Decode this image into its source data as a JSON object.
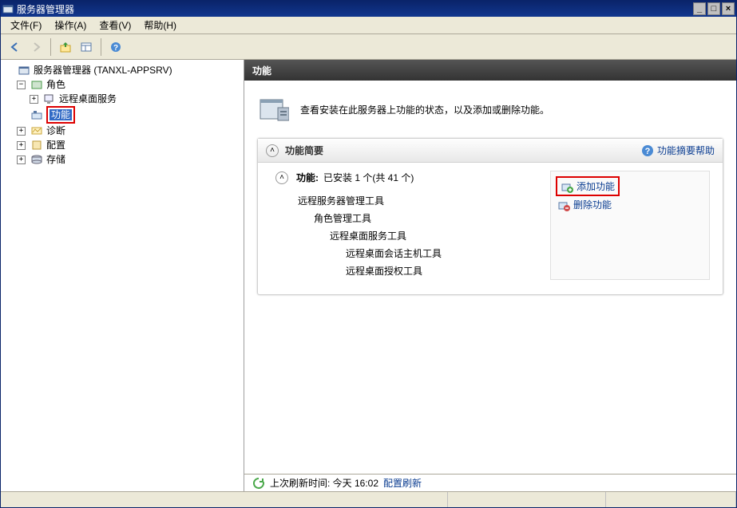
{
  "window": {
    "title": "服务器管理器"
  },
  "menu": {
    "file": "文件(F)",
    "action": "操作(A)",
    "view": "查看(V)",
    "help": "帮助(H)"
  },
  "tree": {
    "root": "服务器管理器 (TANXL-APPSRV)",
    "roles": "角色",
    "remote_desktop": "远程桌面服务",
    "features": "功能",
    "diagnostics": "诊断",
    "config": "配置",
    "storage": "存储"
  },
  "content": {
    "header": "功能",
    "intro": "查看安装在此服务器上功能的状态，以及添加或删除功能。",
    "summary_title": "功能简要",
    "summary_help": "功能摘要帮助",
    "features_label": "功能:",
    "features_count": "已安装 1 个(共 41 个)",
    "add_feature": "添加功能",
    "remove_feature": "删除功能",
    "ftree": {
      "n1": "远程服务器管理工具",
      "n2": "角色管理工具",
      "n3": "远程桌面服务工具",
      "n4": "远程桌面会话主机工具",
      "n5": "远程桌面授权工具"
    }
  },
  "status": {
    "prefix": "上次刷新时间: 今天 16:02",
    "link": "配置刷新"
  }
}
